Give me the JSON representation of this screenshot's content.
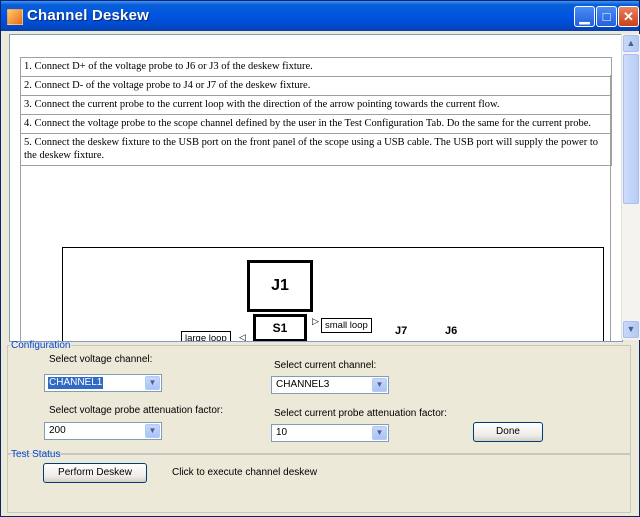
{
  "window": {
    "title": "Channel Deskew"
  },
  "instructions": [
    "1. Connect D+ of the voltage probe to J6 or J3 of the deskew fixture.",
    "2. Connect D- of the voltage probe to J4 or J7 of the deskew fixture.",
    "3. Connect the current probe to the current loop with the direction of the arrow pointing towards the current flow.",
    "4. Connect the voltage probe to the scope channel defined by the user in the Test Configuration Tab. Do the same for the current probe.",
    "5. Connect the deskew fixture to the USB port on the front panel of the scope using a USB cable. The USB port will supply the power to the deskew fixture."
  ],
  "diagram": {
    "j1": "J1",
    "s1": "S1",
    "small_loop": "small loop",
    "large_loop": "large loop",
    "j7": "J7",
    "j6": "J6"
  },
  "configuration": {
    "legend": "Configuration",
    "voltage_channel_label": "Select voltage channel:",
    "voltage_channel_value": "CHANNEL1",
    "current_channel_label": "Select current channel:",
    "current_channel_value": "CHANNEL3",
    "voltage_atten_label": "Select voltage probe attenuation factor:",
    "voltage_atten_value": "200",
    "current_atten_label": "Select current probe attenuation factor:",
    "current_atten_value": "10",
    "done_label": "Done"
  },
  "test_status": {
    "legend": "Test Status",
    "perform_label": "Perform Deskew",
    "hint": "Click to execute channel deskew"
  }
}
